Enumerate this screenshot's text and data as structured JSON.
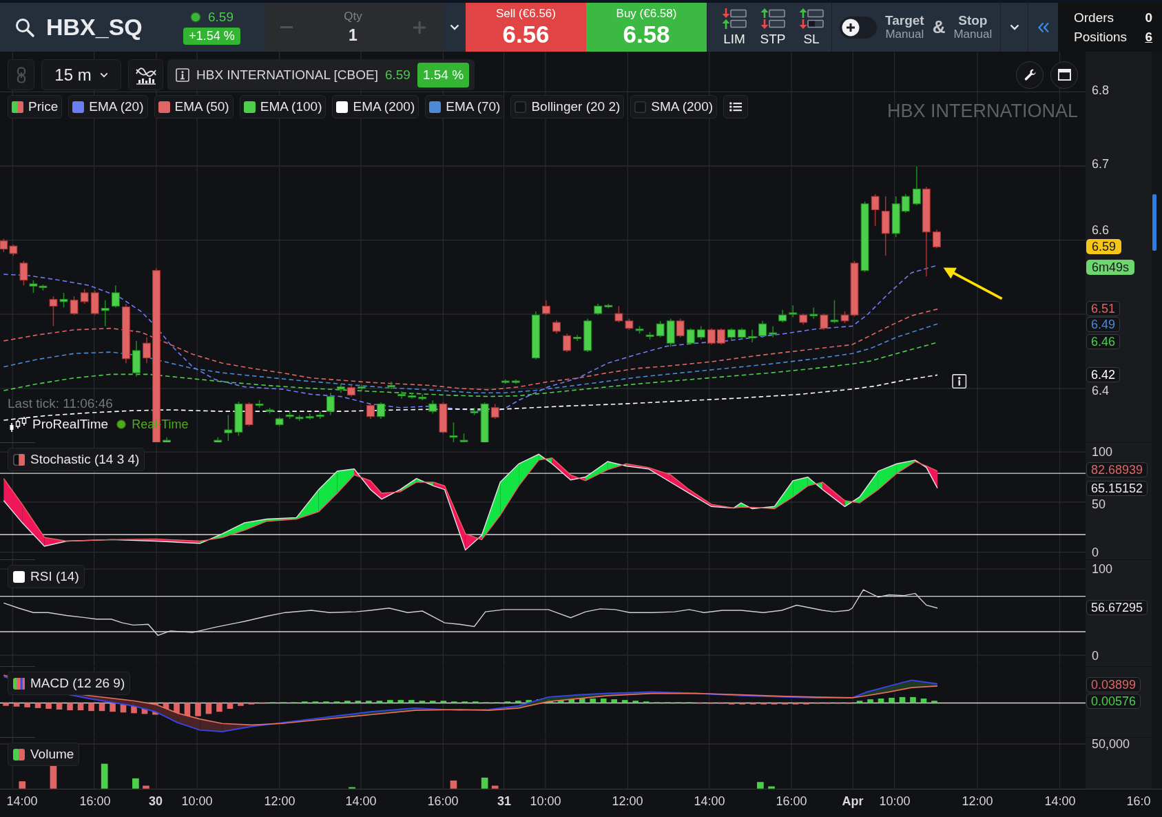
{
  "top_bar": {
    "symbol": "HBX_SQ",
    "last_price": "6.59",
    "change": "+1.54 %",
    "quantity": {
      "label": "Qty",
      "value": "1"
    },
    "sell": {
      "label": "Sell (€6.56)",
      "price": "6.56"
    },
    "buy": {
      "label": "Buy (€6.58)",
      "price": "6.58"
    },
    "order_types": [
      {
        "label": "LIM",
        "kind": "limit"
      },
      {
        "label": "STP",
        "kind": "stop"
      },
      {
        "label": "SL",
        "kind": "stop_loss"
      }
    ],
    "toggle": {
      "on": false
    },
    "target": {
      "label": "Target",
      "mode": "Manual"
    },
    "joiner": "&",
    "stop": {
      "label": "Stop",
      "mode": "Manual"
    },
    "summary": [
      {
        "label": "Orders",
        "value": "0",
        "underlined": false
      },
      {
        "label": "Positions",
        "value": "6",
        "underlined": true
      }
    ]
  },
  "toolbar": {
    "timeframe": "15 m",
    "instrument": "HBX INTERNATIONAL [CBOE]",
    "price": "6.59",
    "change": "1.54 %"
  },
  "legend": [
    {
      "label": "Price",
      "kind": "split",
      "visible": true
    },
    {
      "label": "EMA (20)",
      "kind": "swatch",
      "visible": true,
      "color": "#6b7cf5"
    },
    {
      "label": "EMA (50)",
      "kind": "swatch",
      "visible": true,
      "color": "#e06666"
    },
    {
      "label": "EMA (100)",
      "kind": "swatch",
      "visible": true,
      "color": "#4cd04c"
    },
    {
      "label": "EMA (200)",
      "kind": "swatch",
      "visible": true,
      "color": "#ffffff"
    },
    {
      "label": "EMA (70)",
      "kind": "swatch",
      "visible": true,
      "color": "#4a8ad8"
    },
    {
      "label": "Bollinger (20 2)",
      "kind": "swatch",
      "visible": false
    },
    {
      "label": "SMA (200)",
      "kind": "swatch",
      "visible": false
    }
  ],
  "price_pane": {
    "caption": "HBX INTERNATIONAL",
    "last_tick": "Last tick: 11:06:46",
    "provider": "ProRealTime",
    "feed": "Real-Time",
    "y_ticks": [
      "6.8",
      "6.7",
      "6.6",
      "6.4"
    ],
    "tags": [
      {
        "value": "6.59",
        "kind": "filled",
        "color": "#f5c518"
      },
      {
        "value": "6m49s",
        "kind": "filled",
        "color": "#6ed66e"
      },
      {
        "value": "6.51",
        "kind": "outline",
        "color": "#e06666"
      },
      {
        "value": "6.49",
        "kind": "outline",
        "color": "#4a8ad8"
      },
      {
        "value": "6.46",
        "kind": "outline",
        "color": "#4cd04c"
      },
      {
        "value": "6.42",
        "kind": "outline",
        "color": "#ffffff"
      }
    ]
  },
  "indicators": [
    {
      "kind": "stochastic",
      "name": "Stochastic (14 3 4)",
      "y_ticks": [
        "100",
        "50",
        "0"
      ],
      "tags": [
        {
          "value": "82.68939",
          "color": "#e06666"
        },
        {
          "value": "65.15152",
          "color": "#e8e8e8"
        }
      ]
    },
    {
      "kind": "rsi",
      "name": "RSI (14)",
      "y_ticks": [
        "100",
        "0"
      ],
      "tags": [
        {
          "value": "56.67295",
          "color": "#e8e8e8"
        }
      ]
    },
    {
      "kind": "macd",
      "name": "MACD (12 26 9)",
      "tags": [
        {
          "value": "0.03899",
          "color": "#e06666"
        },
        {
          "value": "0.00576",
          "color": "#4cd04c"
        }
      ]
    },
    {
      "kind": "volume",
      "name": "Volume",
      "y_ticks": [
        "50,000"
      ]
    }
  ],
  "time_axis": [
    {
      "label": "14:00",
      "kind": "time"
    },
    {
      "label": "16:00",
      "kind": "time"
    },
    {
      "label": "30",
      "kind": "day"
    },
    {
      "label": "10:00",
      "kind": "time"
    },
    {
      "label": "12:00",
      "kind": "time"
    },
    {
      "label": "14:00",
      "kind": "time"
    },
    {
      "label": "16:00",
      "kind": "time"
    },
    {
      "label": "31",
      "kind": "day"
    },
    {
      "label": "10:00",
      "kind": "time"
    },
    {
      "label": "12:00",
      "kind": "time"
    },
    {
      "label": "14:00",
      "kind": "time"
    },
    {
      "label": "16:00",
      "kind": "time"
    },
    {
      "label": "Apr",
      "kind": "day"
    },
    {
      "label": "10:00",
      "kind": "time"
    },
    {
      "label": "12:00",
      "kind": "time"
    },
    {
      "label": "14:00",
      "kind": "time"
    },
    {
      "label": "16:0",
      "kind": "time"
    }
  ]
}
